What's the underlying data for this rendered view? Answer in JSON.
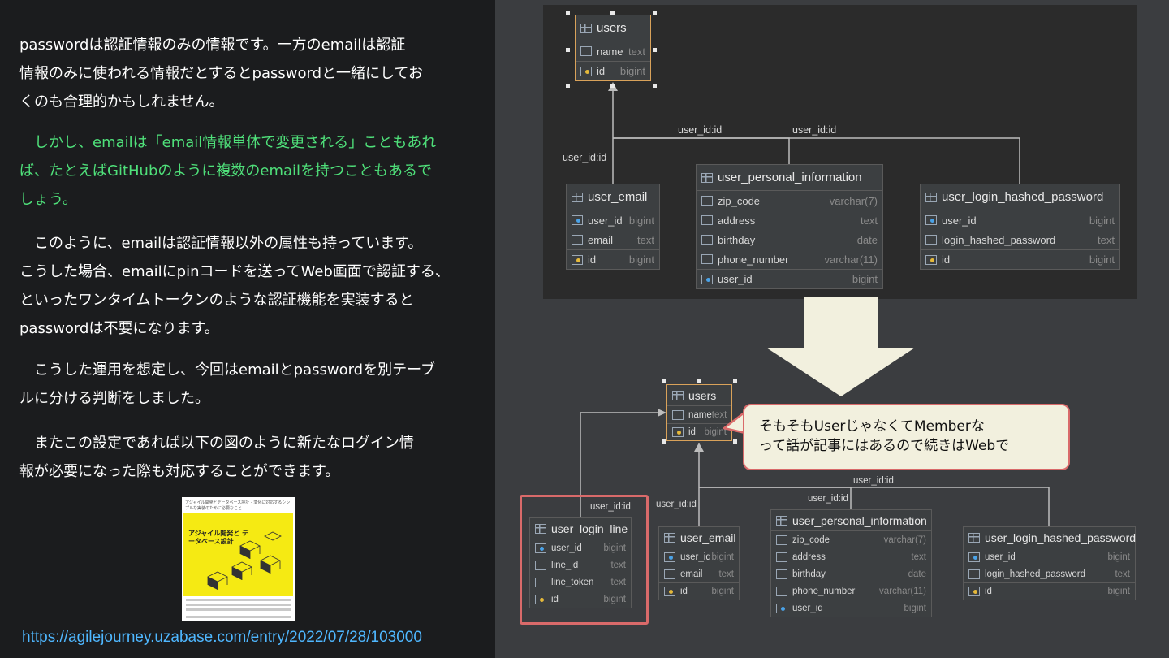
{
  "paragraphs": [
    {
      "lines": [
        "passwordは認証情報のみの情報です。一方のemailは認証",
        "情報のみに使われる情報だとするとpasswordと一緒にしてお",
        "くのも合理的かもしれません。"
      ]
    },
    {
      "lines": [
        "　しかし、emailは「email情報単体で変更される」こともあれ",
        "ば、たとえばGitHubのように複数のemailを持つこともあるで",
        "しょう。"
      ]
    },
    {
      "lines": [
        "　このように、emailは認証情報以外の属性も持っています。",
        "こうした場合、emailにpinコードを送ってWeb画面で認証する、",
        "といったワンタイムトークンのような認証機能を実装すると",
        "passwordは不要になります。"
      ]
    },
    {
      "lines": [
        "　こうした運用を想定し、今回はemailとpasswordを別テーブ",
        "ルに分ける判断をしました。"
      ]
    },
    {
      "lines": [
        "　またこの設定であれば以下の図のように新たなログイン情",
        "報が必要になった際も対応することができます。"
      ]
    }
  ],
  "thumbnail": {
    "title": "アジャイル開発とデータベース設計 - 変化に対応するシンプルな実装のために必要なこと",
    "hero": "アジャイル開発と データベース設計"
  },
  "url": "https://agilejourney.uzabase.com/entry/2022/07/28/103000",
  "diagram_top": {
    "users": {
      "name": "users",
      "cols": [
        {
          "n": "name",
          "t": "text"
        },
        {
          "n": "id",
          "t": "bigint"
        }
      ]
    },
    "user_email": {
      "name": "user_email",
      "cols": [
        {
          "n": "user_id",
          "t": "bigint"
        },
        {
          "n": "email",
          "t": "text"
        },
        {
          "n": "id",
          "t": "bigint"
        }
      ]
    },
    "user_personal_information": {
      "name": "user_personal_information",
      "cols": [
        {
          "n": "zip_code",
          "t": "varchar(7)"
        },
        {
          "n": "address",
          "t": "text"
        },
        {
          "n": "birthday",
          "t": "date"
        },
        {
          "n": "phone_number",
          "t": "varchar(11)"
        },
        {
          "n": "user_id",
          "t": "bigint"
        }
      ]
    },
    "user_login_hashed_password": {
      "name": "user_login_hashed_password",
      "cols": [
        {
          "n": "user_id",
          "t": "bigint"
        },
        {
          "n": "login_hashed_password",
          "t": "text"
        },
        {
          "n": "id",
          "t": "bigint"
        }
      ]
    },
    "labels": [
      "user_id:id",
      "user_id:id",
      "user_id:id"
    ]
  },
  "diagram_bottom": {
    "users": {
      "name": "users",
      "cols": [
        {
          "n": "name",
          "t": "text"
        },
        {
          "n": "id",
          "t": "bigint"
        }
      ]
    },
    "user_login_line": {
      "name": "user_login_line",
      "cols": [
        {
          "n": "user_id",
          "t": "bigint"
        },
        {
          "n": "line_id",
          "t": "text"
        },
        {
          "n": "line_token",
          "t": "text"
        },
        {
          "n": "id",
          "t": "bigint"
        }
      ]
    },
    "user_email": {
      "name": "user_email",
      "cols": [
        {
          "n": "user_id",
          "t": "bigint"
        },
        {
          "n": "email",
          "t": "text"
        },
        {
          "n": "id",
          "t": "bigint"
        }
      ]
    },
    "user_personal_information": {
      "name": "user_personal_information",
      "cols": [
        {
          "n": "zip_code",
          "t": "varchar(7)"
        },
        {
          "n": "address",
          "t": "text"
        },
        {
          "n": "birthday",
          "t": "date"
        },
        {
          "n": "phone_number",
          "t": "varchar(11)"
        },
        {
          "n": "user_id",
          "t": "bigint"
        }
      ]
    },
    "user_login_hashed_password": {
      "name": "user_login_hashed_password",
      "cols": [
        {
          "n": "user_id",
          "t": "bigint"
        },
        {
          "n": "login_hashed_password",
          "t": "text"
        },
        {
          "n": "id",
          "t": "bigint"
        }
      ]
    },
    "labels": [
      "user_id:id",
      "user_id:id",
      "user_id:id",
      "user_id:id"
    ]
  },
  "bubble": {
    "lines": [
      "そもそもUserじゃなくてMemberな",
      "って話が記事にはあるので続きはWebで"
    ]
  },
  "colors": {
    "green_text": "#4fe07a",
    "link": "#4fb7ff",
    "highlight": "#d96a6a"
  }
}
